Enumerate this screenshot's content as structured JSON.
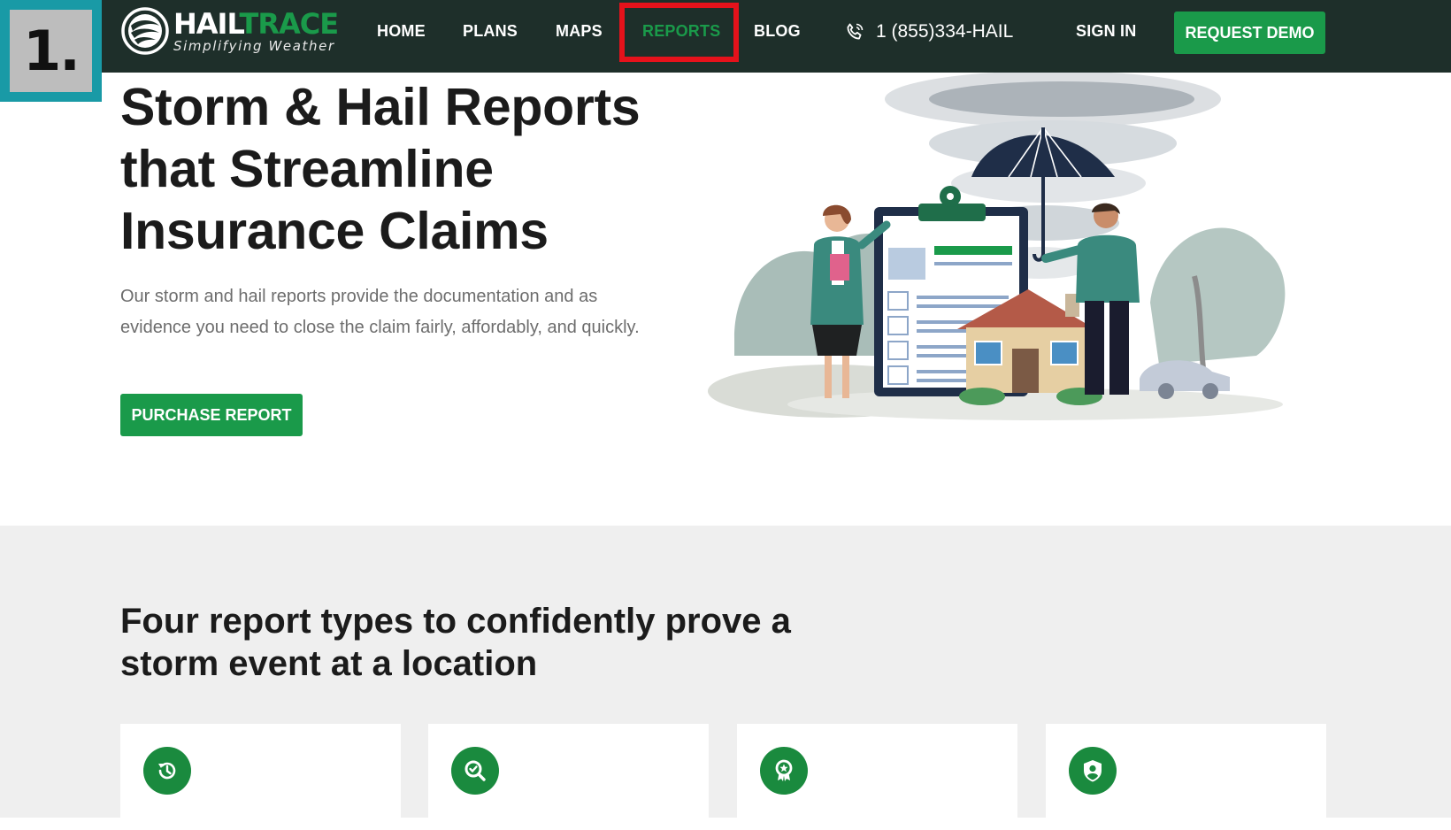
{
  "step_badge": "1.",
  "logo": {
    "name_part1": "HAIL",
    "name_part2": "TRACE",
    "tagline": "Simplifying Weather"
  },
  "nav": {
    "items": [
      {
        "label": "HOME"
      },
      {
        "label": "PLANS"
      },
      {
        "label": "MAPS"
      },
      {
        "label": "REPORTS",
        "active": true
      },
      {
        "label": "BLOG"
      }
    ],
    "phone": "1 (855)334-HAIL",
    "sign_in": "SIGN IN",
    "request_demo": "REQUEST DEMO"
  },
  "hero": {
    "title_line1": "Storm & Hail Reports",
    "title_line2": "that Streamline",
    "title_line3": "Insurance Claims",
    "description": "Our storm and hail reports provide the documentation and as evidence you need to close the claim fairly, affordably, and quickly.",
    "cta": "PURCHASE REPORT"
  },
  "section2": {
    "title_line1": "Four report types to confidently prove a",
    "title_line2": "storm event at a location",
    "cards": [
      {
        "icon": "history-icon"
      },
      {
        "icon": "search-check-icon"
      },
      {
        "icon": "award-ribbon-icon"
      },
      {
        "icon": "shield-user-icon"
      }
    ]
  },
  "colors": {
    "nav_bg": "#1e2f2a",
    "brand_green": "#1a9a4a",
    "highlight_red": "#e5121b",
    "badge_teal": "#199aa6",
    "section_bg": "#efefef"
  }
}
